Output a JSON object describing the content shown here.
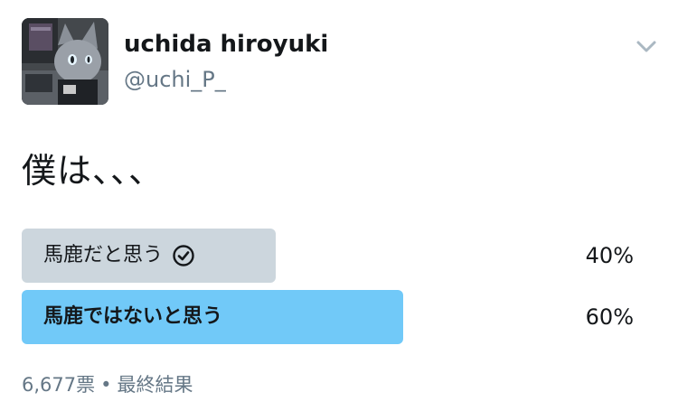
{
  "author": {
    "display_name": "uchida hiroyuki",
    "handle": "@uchi_P_"
  },
  "tweet": {
    "text": "僕は、、、"
  },
  "poll": {
    "options": [
      {
        "label": "馬鹿だと思う",
        "percent": 40,
        "percent_label": "40%",
        "voted": true,
        "bar_color": "#ccd6dd"
      },
      {
        "label": "馬鹿ではないと思う",
        "percent": 60,
        "percent_label": "60%",
        "voted": false,
        "leading": true,
        "bar_color": "#71c9f8"
      }
    ],
    "votes_label": "6,677票",
    "separator": "•",
    "status_label": "最終結果"
  },
  "icons": {
    "caret": "chevron-down-icon",
    "voted": "check-circle-icon",
    "avatar": "cat-mask-avatar"
  },
  "colors": {
    "name_text": "#14171a",
    "secondary_text": "#657786",
    "voted_bar": "#ccd6dd",
    "leading_bar": "#71c9f8"
  }
}
